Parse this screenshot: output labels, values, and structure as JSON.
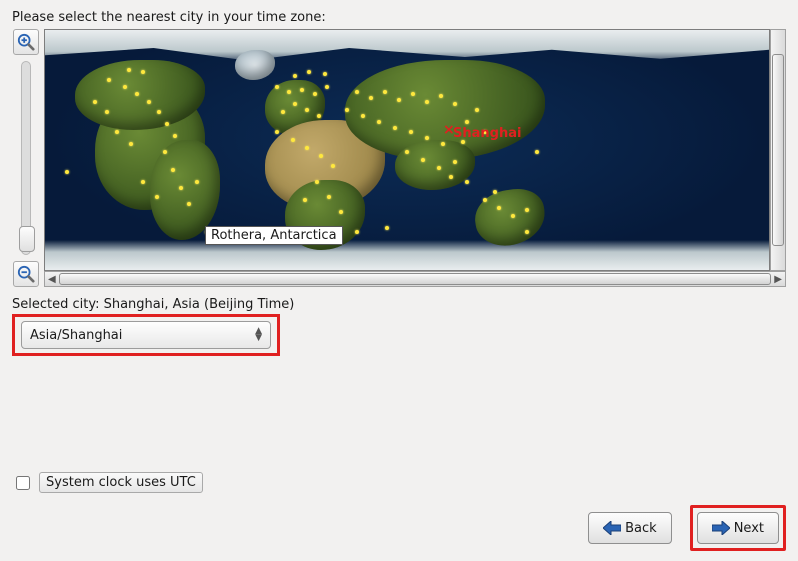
{
  "prompt": "Please select the nearest city in your time zone:",
  "map": {
    "marker_city": "Shanghai",
    "tooltip": "Rothera, Antarctica"
  },
  "selected_line": "Selected city: Shanghai, Asia (Beijing Time)",
  "timezone_combo": {
    "value": "Asia/Shanghai"
  },
  "utc_checkbox": {
    "checked": false,
    "label": "System clock uses UTC"
  },
  "buttons": {
    "back": "Back",
    "next": "Next"
  },
  "icons": {
    "zoom_in": "zoom-in-icon",
    "zoom_out": "zoom-out-icon",
    "arrow_left": "◀",
    "arrow_right": "▶"
  }
}
